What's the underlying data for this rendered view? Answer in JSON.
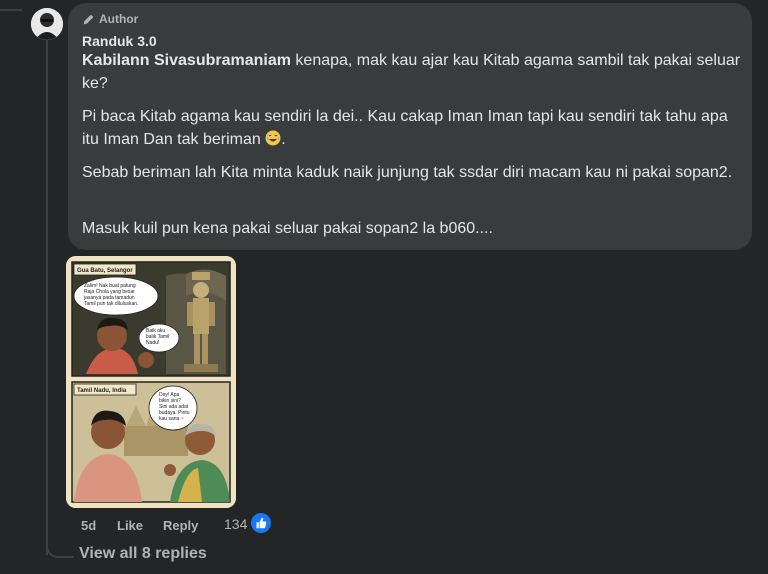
{
  "comment": {
    "badge": "Author",
    "author_name": "Randuk 3.0",
    "mention": "Kabilann Sivasubramaniam",
    "para1_rest": " kenapa, mak kau ajar kau Kitab agama sambil tak pakai seluar ke?",
    "para2": "Pi baca Kitab agama kau sendiri la dei.. Kau cakap Iman Iman tapi kau sendiri tak tahu apa itu Iman Dan tak beriman",
    "para2_end": ".",
    "para3": "Sebab beriman lah Kita minta kaduk naik junjung tak ssdar diri macam kau ni pakai sopan2.",
    "para4": "Masuk kuil pun kena pakai seluar pakai sopan2 la b060....",
    "emoji": "laughing-emoji"
  },
  "comic": {
    "panel1_caption": "Gua Batu, Selangor",
    "panel1_bubble1": "Zalim! Nak buat patung Raja Chola yang besar jasanya pada tamadun Tamil pun tak diluluskan.",
    "panel1_bubble2": "Baik aku balik Tamil Nadu!",
    "panel2_caption": "Tamil Nadu, India",
    "panel2_bubble": "Dey! Apa bikin sini? Sini ada adat budaya. Pintu kau sana ~"
  },
  "actions": {
    "time": "5d",
    "like": "Like",
    "reply": "Reply",
    "reaction_count": "134"
  },
  "replies": {
    "view_all": "View all 8 replies"
  },
  "colors": {
    "background": "#242526",
    "bubble": "#3a3b3c",
    "text": "#e4e6eb",
    "secondary": "#b0b3b8",
    "like_blue": "#1877f2"
  }
}
